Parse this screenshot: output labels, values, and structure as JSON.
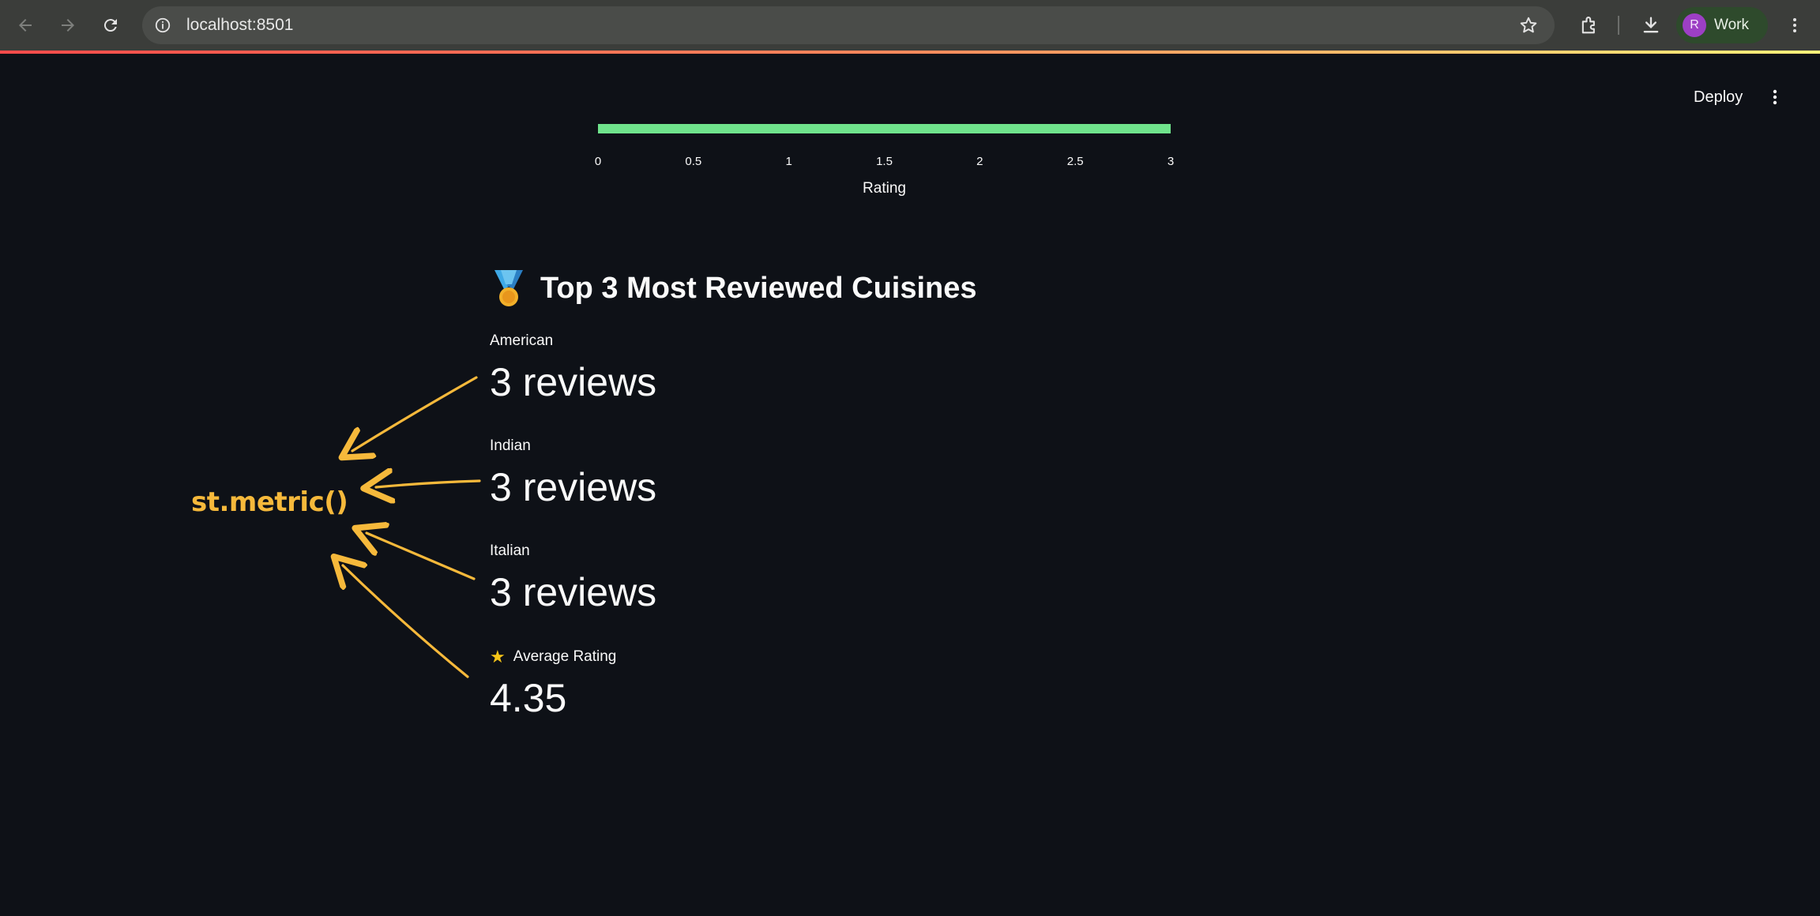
{
  "browser": {
    "url": "localhost:8501",
    "profile_initial": "R",
    "profile_name": "Work"
  },
  "app": {
    "deploy_label": "Deploy"
  },
  "chart_data": {
    "type": "bar",
    "orientation": "horizontal",
    "values": [
      3
    ],
    "xlabel": "Rating",
    "xlim": [
      0,
      3
    ],
    "x_ticks": [
      "0",
      "0.5",
      "1",
      "1.5",
      "2",
      "2.5",
      "3"
    ],
    "bar_color": "#6fe38c",
    "grid": false
  },
  "section": {
    "title": "Top 3 Most Reviewed Cuisines",
    "icon": "medal-icon"
  },
  "metrics": [
    {
      "label": "American",
      "value": "3 reviews"
    },
    {
      "label": "Indian",
      "value": "3 reviews"
    },
    {
      "label": "Italian",
      "value": "3 reviews"
    },
    {
      "label": "Average Rating",
      "value": "4.35",
      "icon": "star-icon"
    }
  ],
  "annotation": {
    "label": "st.metric()",
    "color": "#f6b93b"
  }
}
